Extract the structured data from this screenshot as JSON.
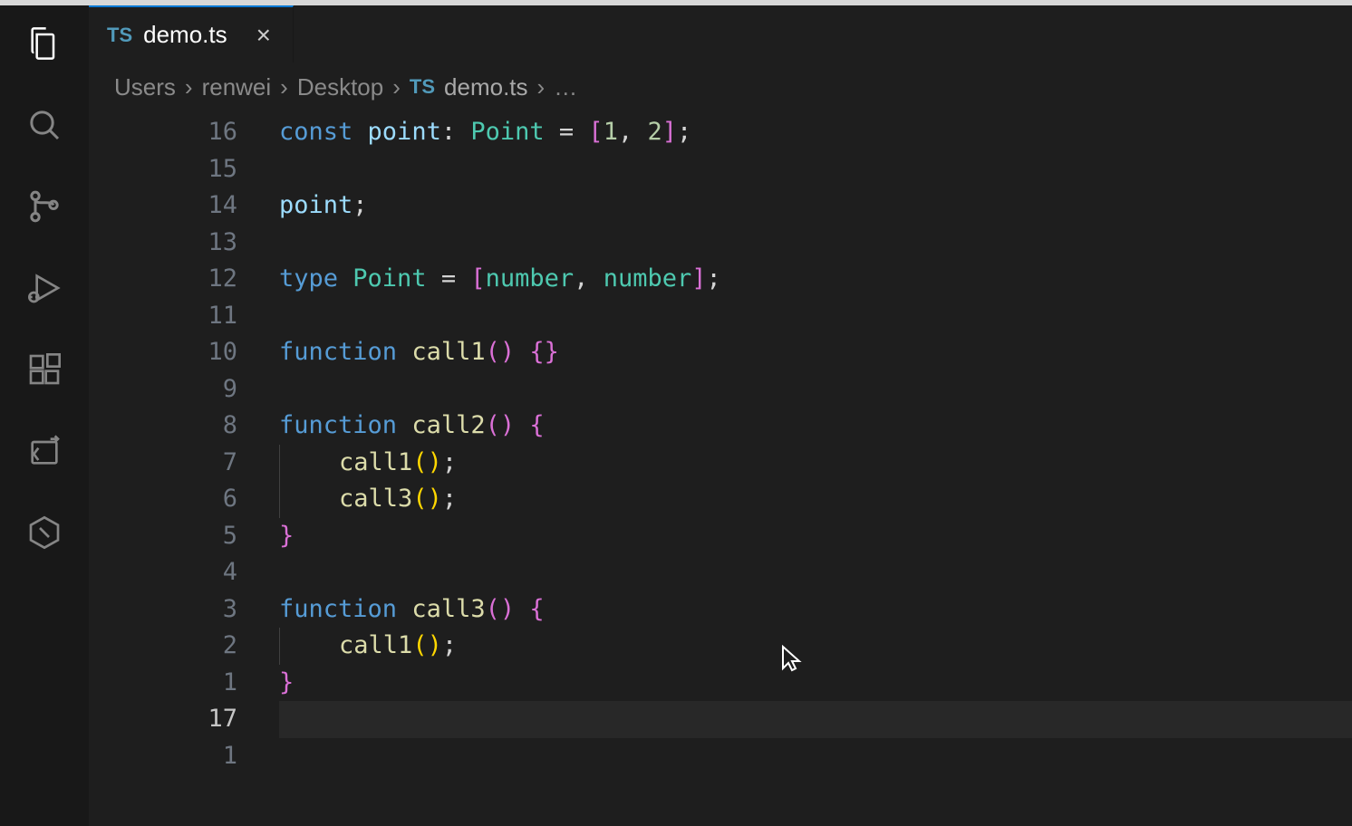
{
  "tab": {
    "icon_label": "TS",
    "filename": "demo.ts"
  },
  "breadcrumbs": {
    "items": [
      "Users",
      "renwei",
      "Desktop"
    ],
    "file_icon": "TS",
    "file": "demo.ts",
    "suffix": "…"
  },
  "line_numbers": [
    "16",
    "15",
    "14",
    "13",
    "12",
    "11",
    "10",
    "9",
    "8",
    "7",
    "6",
    "5",
    "4",
    "3",
    "2",
    "1",
    "17",
    "1"
  ],
  "current_line_index": 16,
  "code_lines": [
    {
      "tokens": [
        [
          "keyword",
          "const "
        ],
        [
          "var",
          "point"
        ],
        [
          "punct",
          ": "
        ],
        [
          "type",
          "Point"
        ],
        [
          "punct",
          " "
        ],
        [
          "op",
          "="
        ],
        [
          "punct",
          " "
        ],
        [
          "brace-pink",
          "["
        ],
        [
          "num",
          "1"
        ],
        [
          "punct",
          ", "
        ],
        [
          "num",
          "2"
        ],
        [
          "brace-pink",
          "]"
        ],
        [
          "punct",
          ";"
        ]
      ]
    },
    {
      "tokens": []
    },
    {
      "tokens": [
        [
          "var",
          "point"
        ],
        [
          "punct",
          ";"
        ]
      ]
    },
    {
      "tokens": []
    },
    {
      "tokens": [
        [
          "keyword",
          "type "
        ],
        [
          "type",
          "Point"
        ],
        [
          "punct",
          " "
        ],
        [
          "op",
          "="
        ],
        [
          "punct",
          " "
        ],
        [
          "brace-pink",
          "["
        ],
        [
          "type",
          "number"
        ],
        [
          "punct",
          ", "
        ],
        [
          "type",
          "number"
        ],
        [
          "brace-pink",
          "]"
        ],
        [
          "punct",
          ";"
        ]
      ]
    },
    {
      "tokens": []
    },
    {
      "tokens": [
        [
          "keyword",
          "function "
        ],
        [
          "func",
          "call1"
        ],
        [
          "brace-pink",
          "()"
        ],
        [
          "punct",
          " "
        ],
        [
          "brace-pink",
          "{}"
        ]
      ]
    },
    {
      "tokens": []
    },
    {
      "tokens": [
        [
          "keyword",
          "function "
        ],
        [
          "func",
          "call2"
        ],
        [
          "brace-pink",
          "()"
        ],
        [
          "punct",
          " "
        ],
        [
          "brace-pink",
          "{"
        ]
      ]
    },
    {
      "indent": 1,
      "tokens": [
        [
          "func",
          "call1"
        ],
        [
          "brace",
          "()"
        ],
        [
          "punct",
          ";"
        ]
      ]
    },
    {
      "indent": 1,
      "tokens": [
        [
          "func",
          "call3"
        ],
        [
          "brace",
          "()"
        ],
        [
          "punct",
          ";"
        ]
      ]
    },
    {
      "tokens": [
        [
          "brace-pink",
          "}"
        ]
      ]
    },
    {
      "tokens": []
    },
    {
      "tokens": [
        [
          "keyword",
          "function "
        ],
        [
          "func",
          "call3"
        ],
        [
          "brace-pink",
          "()"
        ],
        [
          "punct",
          " "
        ],
        [
          "brace-pink",
          "{"
        ]
      ]
    },
    {
      "indent": 1,
      "tokens": [
        [
          "func",
          "call1"
        ],
        [
          "brace",
          "()"
        ],
        [
          "punct",
          ";"
        ]
      ]
    },
    {
      "tokens": [
        [
          "brace-pink",
          "}"
        ]
      ]
    },
    {
      "tokens": [],
      "current": true
    },
    {
      "tokens": []
    }
  ]
}
